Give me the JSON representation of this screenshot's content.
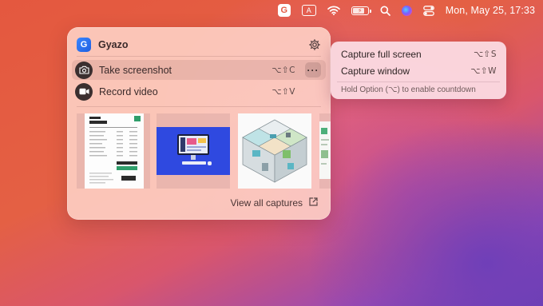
{
  "menubar": {
    "gyazo_glyph": "G",
    "input_glyph": "A",
    "battery_bolt": "⚡",
    "clock": "Mon, May 25, 17:33",
    "icons": [
      "gyazo-icon",
      "input-source-icon",
      "wifi-icon",
      "battery-icon",
      "search-icon",
      "siri-icon",
      "control-center-icon"
    ]
  },
  "panel": {
    "app_logo_glyph": "G",
    "app_name": "Gyazo",
    "actions": [
      {
        "label": "Take screenshot",
        "shortcut": "⌥⇧C",
        "icon": "camera-icon"
      },
      {
        "label": "Record video",
        "shortcut": "⌥⇧V",
        "icon": "video-icon"
      }
    ],
    "more_label": "···",
    "view_all": "View all captures"
  },
  "submenu": {
    "items": [
      {
        "label": "Capture full screen",
        "shortcut": "⌥⇧S"
      },
      {
        "label": "Capture window",
        "shortcut": "⌥⇧W"
      }
    ],
    "hint": "Hold Option (⌥) to enable countdown"
  },
  "colors": {
    "accent_blue": "#2f49e0",
    "gyazo_blue": "#1f5fe0",
    "panel_bg": "#ffd6cb"
  }
}
